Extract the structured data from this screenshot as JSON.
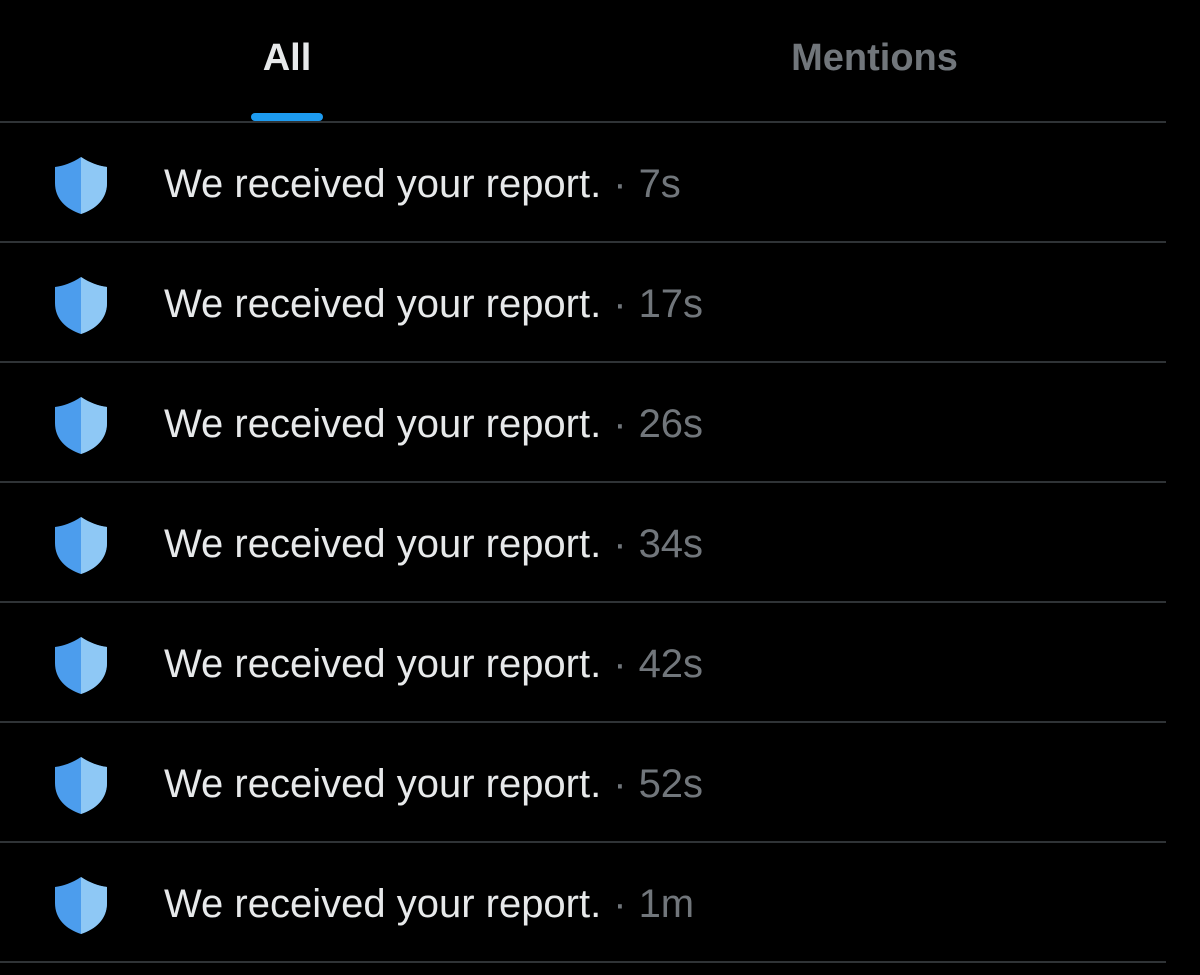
{
  "colors": {
    "background": "#000000",
    "accent": "#1d9bf0",
    "shield_dark": "#4c9ded",
    "shield_light": "#8ec8f5",
    "text_primary": "#e7e9ea",
    "text_secondary": "#71767b",
    "divider": "#2f3336"
  },
  "tabs": [
    {
      "label": "All",
      "active": true
    },
    {
      "label": "Mentions",
      "active": false
    }
  ],
  "notifications": [
    {
      "icon": "shield-icon",
      "message": "We received your report.",
      "separator": "·",
      "time": "7s"
    },
    {
      "icon": "shield-icon",
      "message": "We received your report.",
      "separator": "·",
      "time": "17s"
    },
    {
      "icon": "shield-icon",
      "message": "We received your report.",
      "separator": "·",
      "time": "26s"
    },
    {
      "icon": "shield-icon",
      "message": "We received your report.",
      "separator": "·",
      "time": "34s"
    },
    {
      "icon": "shield-icon",
      "message": "We received your report.",
      "separator": "·",
      "time": "42s"
    },
    {
      "icon": "shield-icon",
      "message": "We received your report.",
      "separator": "·",
      "time": "52s"
    },
    {
      "icon": "shield-icon",
      "message": "We received your report.",
      "separator": "·",
      "time": "1m"
    }
  ]
}
